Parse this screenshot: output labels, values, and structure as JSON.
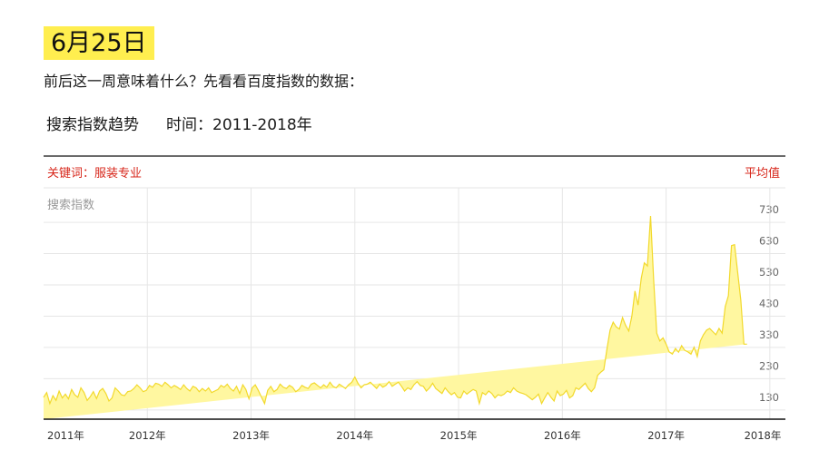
{
  "header": {
    "date_badge": "6月25日",
    "subtitle": "前后这一周意味着什么？先看看百度指数的数据："
  },
  "chart_heading": {
    "label": "搜索指数趋势",
    "time_label": "时间：2011-2018年"
  },
  "colors": {
    "badge_bg": "#ffee4f",
    "accent_red": "#d7261a",
    "area_fill": "#fff7a0",
    "area_stroke": "#f2d92c",
    "grid": "#e6e6e6",
    "axis": "#111111",
    "muted": "#999999"
  },
  "chart_data": {
    "type": "area",
    "keyword_label": "关键词：服装专业",
    "legend_label": "平均值",
    "ylabel": "搜索指数",
    "ylim": [
      60,
      765
    ],
    "yticks": [
      130,
      230,
      330,
      430,
      530,
      630,
      730
    ],
    "xlim": [
      2011.0,
      2018.15
    ],
    "xticks": [
      {
        "value": 2011.0,
        "label": "2011年"
      },
      {
        "value": 2012.0,
        "label": "2012年"
      },
      {
        "value": 2013.0,
        "label": "2013年"
      },
      {
        "value": 2014.0,
        "label": "2014年"
      },
      {
        "value": 2015.0,
        "label": "2015年"
      },
      {
        "value": 2016.0,
        "label": "2016年"
      },
      {
        "value": 2017.0,
        "label": "2017年"
      },
      {
        "value": 2018.0,
        "label": "2018年"
      }
    ],
    "x": [
      2011.0,
      2011.03,
      2011.06,
      2011.09,
      2011.12,
      2011.15,
      2011.18,
      2011.21,
      2011.24,
      2011.27,
      2011.3,
      2011.33,
      2011.36,
      2011.39,
      2011.42,
      2011.45,
      2011.48,
      2011.51,
      2011.54,
      2011.57,
      2011.6,
      2011.63,
      2011.66,
      2011.69,
      2011.72,
      2011.75,
      2011.78,
      2011.81,
      2011.84,
      2011.87,
      2011.9,
      2011.93,
      2011.96,
      2011.99,
      2012.02,
      2012.05,
      2012.08,
      2012.11,
      2012.14,
      2012.17,
      2012.2,
      2012.23,
      2012.26,
      2012.29,
      2012.32,
      2012.35,
      2012.38,
      2012.41,
      2012.44,
      2012.47,
      2012.5,
      2012.53,
      2012.56,
      2012.59,
      2012.62,
      2012.65,
      2012.68,
      2012.71,
      2012.74,
      2012.77,
      2012.8,
      2012.83,
      2012.86,
      2012.89,
      2012.92,
      2012.95,
      2012.98,
      2013.01,
      2013.04,
      2013.07,
      2013.1,
      2013.13,
      2013.16,
      2013.19,
      2013.22,
      2013.25,
      2013.28,
      2013.31,
      2013.34,
      2013.37,
      2013.4,
      2013.43,
      2013.46,
      2013.49,
      2013.52,
      2013.55,
      2013.58,
      2013.61,
      2013.64,
      2013.67,
      2013.7,
      2013.73,
      2013.76,
      2013.79,
      2013.82,
      2013.85,
      2013.88,
      2013.91,
      2013.94,
      2013.97,
      2014.0,
      2014.03,
      2014.06,
      2014.09,
      2014.12,
      2014.15,
      2014.18,
      2014.21,
      2014.24,
      2014.27,
      2014.3,
      2014.33,
      2014.36,
      2014.39,
      2014.42,
      2014.45,
      2014.48,
      2014.51,
      2014.54,
      2014.57,
      2014.6,
      2014.63,
      2014.66,
      2014.69,
      2014.72,
      2014.75,
      2014.78,
      2014.81,
      2014.84,
      2014.87,
      2014.9,
      2014.93,
      2014.96,
      2014.99,
      2015.02,
      2015.05,
      2015.08,
      2015.11,
      2015.14,
      2015.17,
      2015.2,
      2015.23,
      2015.26,
      2015.29,
      2015.32,
      2015.35,
      2015.38,
      2015.41,
      2015.44,
      2015.47,
      2015.5,
      2015.53,
      2015.56,
      2015.59,
      2015.62,
      2015.65,
      2015.68,
      2015.71,
      2015.74,
      2015.77,
      2015.8,
      2015.83,
      2015.86,
      2015.89,
      2015.92,
      2015.95,
      2015.98,
      2016.01,
      2016.04,
      2016.07,
      2016.1,
      2016.13,
      2016.16,
      2016.19,
      2016.22,
      2016.25,
      2016.28,
      2016.31,
      2016.34,
      2016.37,
      2016.4,
      2016.43,
      2016.46,
      2016.49,
      2016.52,
      2016.55,
      2016.58,
      2016.61,
      2016.64,
      2016.67,
      2016.7,
      2016.73,
      2016.76,
      2016.79,
      2016.82,
      2016.85,
      2016.88,
      2016.91,
      2016.94,
      2016.97,
      2017.0,
      2017.03,
      2017.06,
      2017.09,
      2017.12,
      2017.15,
      2017.18,
      2017.21,
      2017.24,
      2017.27,
      2017.3,
      2017.33,
      2017.36,
      2017.39,
      2017.42,
      2017.45,
      2017.48,
      2017.51,
      2017.54,
      2017.57,
      2017.6,
      2017.63,
      2017.66,
      2017.69,
      2017.72,
      2017.75,
      2017.78,
      2017.81,
      2017.84,
      2017.87,
      2017.9,
      2017.93,
      2017.96,
      2017.99,
      2018.02,
      2018.05,
      2018.08,
      2018.11,
      2018.14
    ],
    "values": [
      130,
      145,
      110,
      135,
      120,
      150,
      128,
      140,
      125,
      155,
      138,
      130,
      160,
      145,
      120,
      132,
      148,
      126,
      150,
      158,
      142,
      118,
      128,
      160,
      150,
      138,
      135,
      148,
      150,
      158,
      170,
      160,
      148,
      152,
      168,
      162,
      175,
      172,
      165,
      178,
      170,
      160,
      168,
      162,
      155,
      170,
      158,
      150,
      165,
      160,
      148,
      158,
      150,
      160,
      145,
      150,
      155,
      168,
      162,
      172,
      158,
      150,
      165,
      142,
      170,
      155,
      125,
      160,
      170,
      152,
      130,
      110,
      152,
      165,
      148,
      155,
      172,
      162,
      158,
      168,
      162,
      148,
      155,
      168,
      162,
      158,
      172,
      176,
      168,
      160,
      170,
      162,
      178,
      165,
      160,
      172,
      165,
      158,
      170,
      178,
      195,
      175,
      160,
      170,
      172,
      178,
      168,
      158,
      172,
      162,
      168,
      180,
      165,
      172,
      178,
      165,
      150,
      160,
      155,
      170,
      180,
      168,
      165,
      150,
      160,
      175,
      158,
      150,
      142,
      160,
      148,
      138,
      145,
      130,
      128,
      150,
      140,
      148,
      155,
      150,
      110,
      145,
      138,
      150,
      142,
      128,
      138,
      135,
      140,
      150,
      145,
      160,
      150,
      145,
      142,
      138,
      130,
      122,
      130,
      140,
      110,
      128,
      145,
      130,
      118,
      150,
      135,
      140,
      152,
      128,
      135,
      160,
      155,
      165,
      175,
      158,
      148,
      160,
      200,
      210,
      218,
      285,
      345,
      370,
      355,
      348,
      385,
      360,
      342,
      390,
      470,
      425,
      510,
      560,
      550,
      710,
      505,
      335,
      310,
      320,
      300,
      275,
      268,
      286,
      274,
      295,
      280,
      275,
      268,
      290,
      260,
      310,
      330,
      345,
      350,
      340,
      330,
      350,
      335,
      420,
      455,
      615,
      618,
      530,
      440,
      300,
      300
    ],
    "label_annotations": []
  }
}
